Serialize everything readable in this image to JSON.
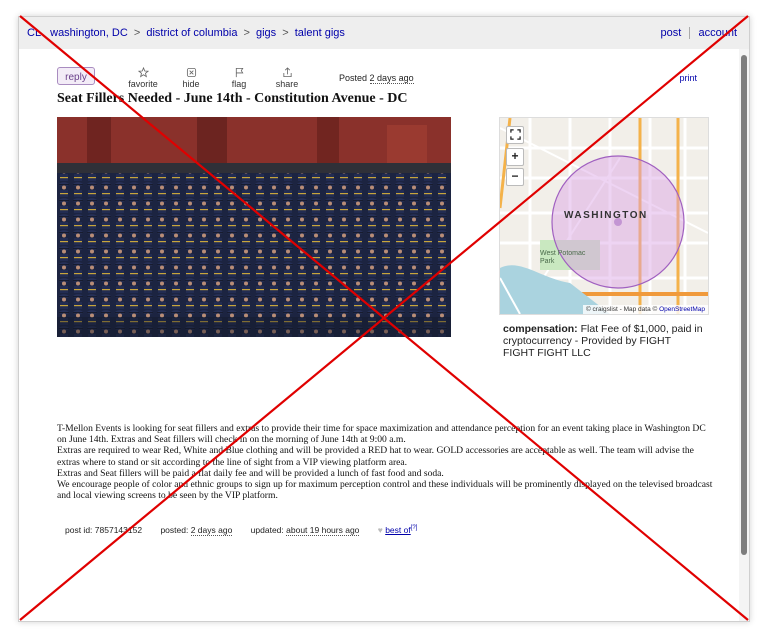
{
  "topbar": {
    "logo": "CL",
    "crumbs": [
      "washington, DC",
      "district of columbia",
      "gigs",
      "talent gigs"
    ],
    "separator": ">",
    "post_label": "post",
    "account_label": "account"
  },
  "actions": {
    "reply_label": "reply",
    "favorite_label": "favorite",
    "hide_label": "hide",
    "flag_label": "flag",
    "share_label": "share",
    "posted_prefix": "Posted",
    "posted_value": "2 days ago",
    "print_label": "print"
  },
  "post": {
    "title": "Seat Fillers Needed - June 14th - Constitution Avenue - DC",
    "compensation_label": "compensation:",
    "compensation_value": "Flat Fee of $1,000, paid in cryptocurrency - Provided by FIGHT FIGHT FIGHT LLC",
    "body": [
      "T-Mellon Events is looking for seat fillers and extras to provide their time for space maximization and attendance perception for an event taking place in Washington DC on June 14th. Extras and Seat fillers will check in on the morning of June 14th at 9:00 a.m.",
      "Extras are required to wear Red, White and Blue clothing and will be provided a RED hat to wear. GOLD accessories are acceptable as well. The team will advise the extras where to stand or sit according to the line of sight from a VIP viewing platform area.",
      "Extras and Seat fillers will be paid a flat daily fee and will be provided a lunch of fast food and soda.",
      "We encourage people of color and ethnic groups to sign up for maximum perception control and these individuals will be prominently displayed on the televised broadcast and local viewing screens to be seen by the VIP platform."
    ]
  },
  "map": {
    "city_label": "WASHINGTON",
    "park_label": "West Potomac Park",
    "zoom_in": "+",
    "zoom_out": "−",
    "fullscreen": "⛶",
    "attribution_prefix": "© craigslist - Map data ©",
    "attribution_link": "OpenStreetMap",
    "circle_color": "#c070d8"
  },
  "footer": {
    "post_id_label": "post id:",
    "post_id_value": "7857143152",
    "posted_label": "posted:",
    "posted_value": "2 days ago",
    "updated_label": "updated:",
    "updated_value": "about 19 hours ago",
    "best_of_label": "best of",
    "best_of_sup": "[?]"
  },
  "colors": {
    "link": "#0000aa",
    "overlay_x": "#e00000",
    "reply_border": "#a98cc0"
  }
}
